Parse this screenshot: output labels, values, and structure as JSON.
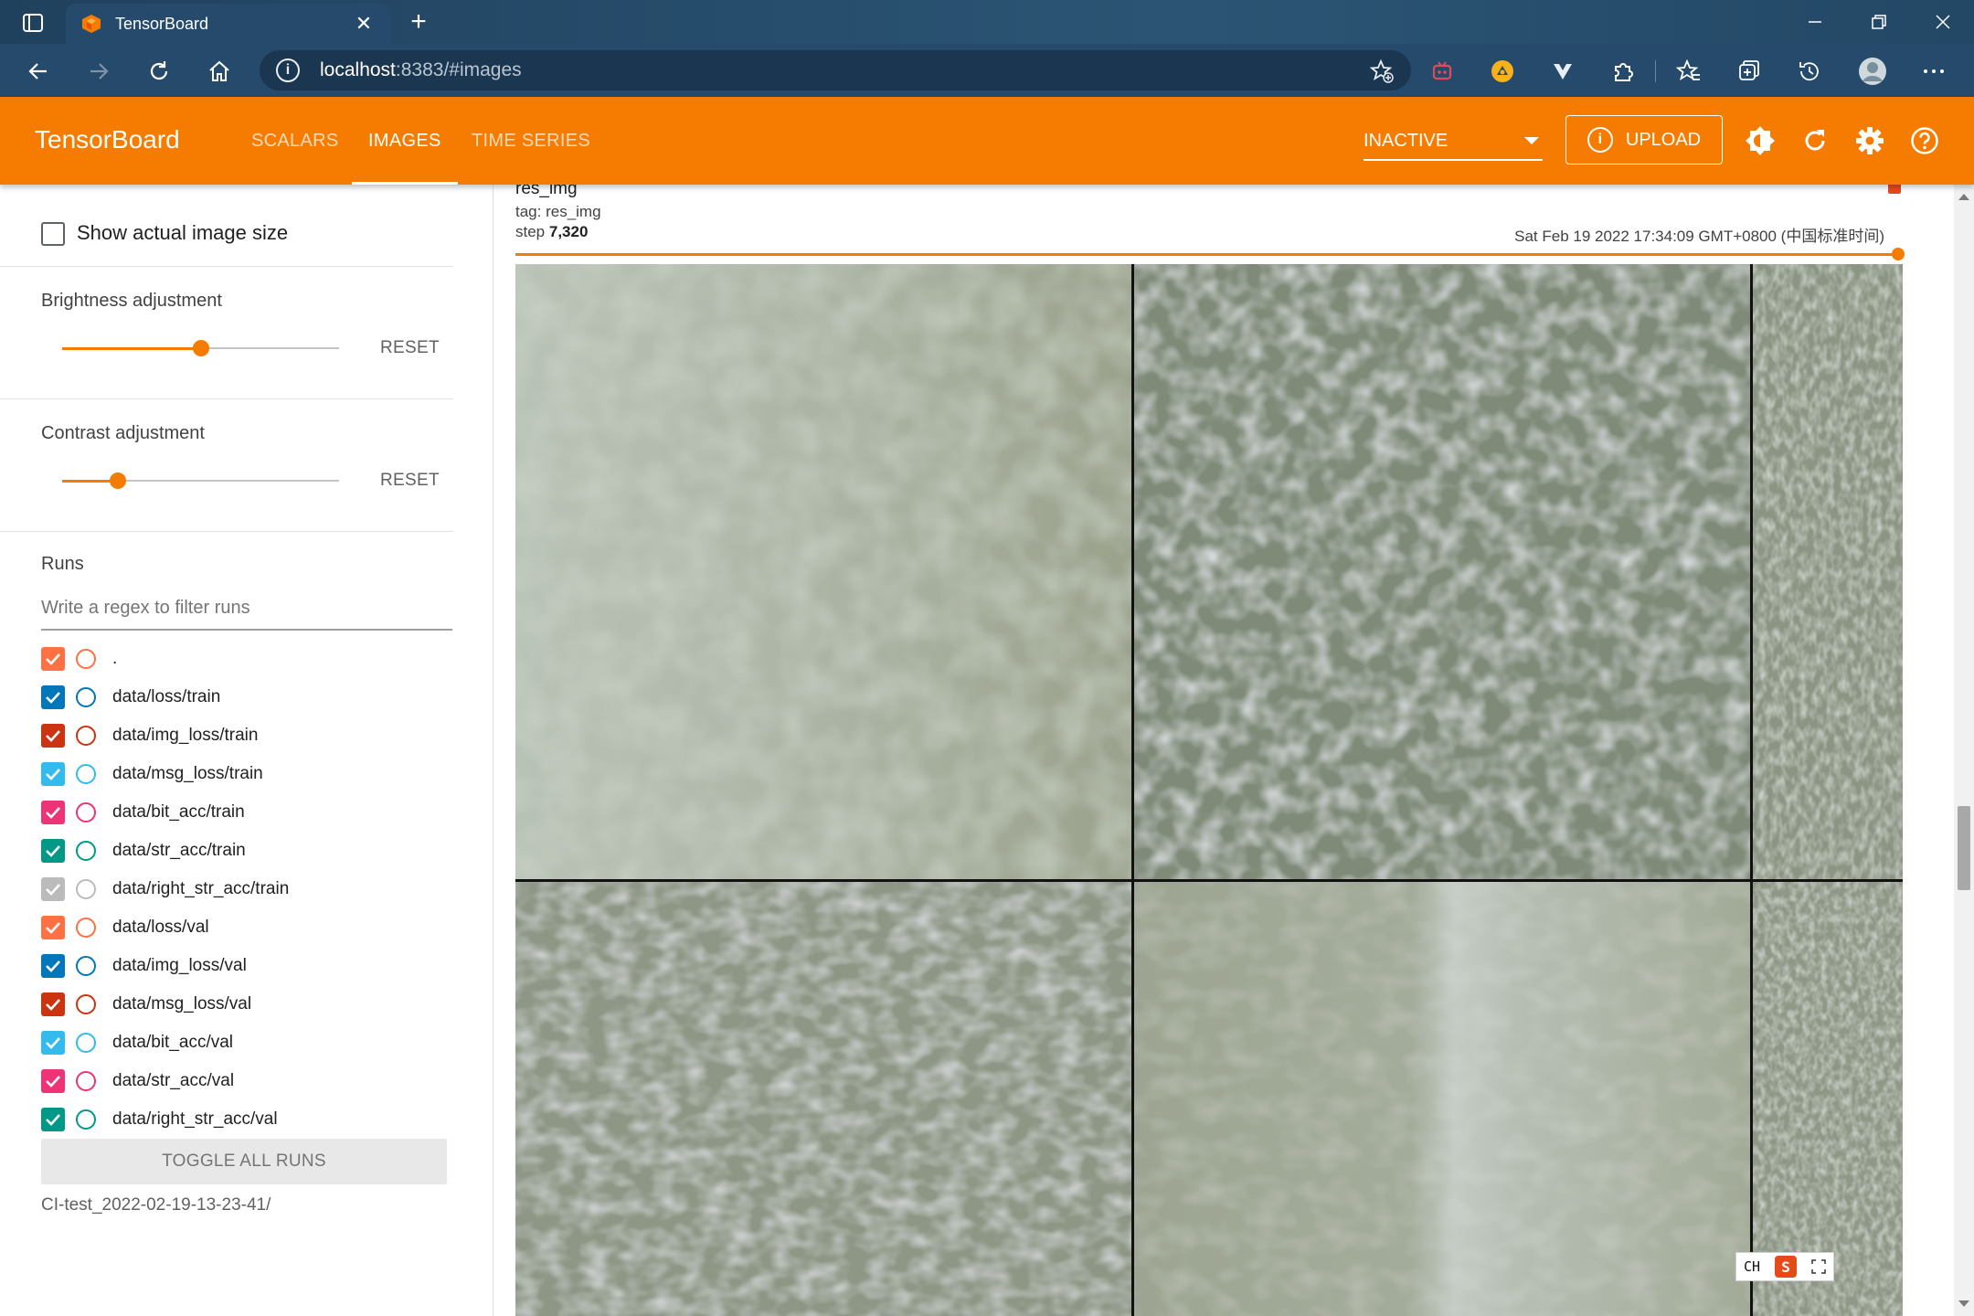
{
  "browser": {
    "tab_title": "TensorBoard",
    "url_host": "localhost",
    "url_rest": ":8383/#images"
  },
  "header": {
    "brand": "TensorBoard",
    "tabs": [
      {
        "label": "SCALARS",
        "active": false
      },
      {
        "label": "IMAGES",
        "active": true
      },
      {
        "label": "TIME SERIES",
        "active": false
      }
    ],
    "select_value": "INACTIVE",
    "upload_label": "UPLOAD",
    "accent_color": "#f57c00"
  },
  "sidebar": {
    "show_actual_size_label": "Show actual image size",
    "brightness": {
      "label": "Brightness adjustment",
      "reset": "RESET",
      "value_fraction": 0.5
    },
    "contrast": {
      "label": "Contrast adjustment",
      "reset": "RESET",
      "value_fraction": 0.2
    },
    "runs_heading": "Runs",
    "filter_placeholder": "Write a regex to filter runs",
    "runs": [
      {
        "name": ".",
        "color": "#ff7043",
        "checked": true
      },
      {
        "name": "data/loss/train",
        "color": "#0077bb",
        "checked": true
      },
      {
        "name": "data/img_loss/train",
        "color": "#cc3311",
        "checked": true
      },
      {
        "name": "data/msg_loss/train",
        "color": "#33bbee",
        "checked": true
      },
      {
        "name": "data/bit_acc/train",
        "color": "#ee3377",
        "checked": true
      },
      {
        "name": "data/str_acc/train",
        "color": "#009988",
        "checked": true
      },
      {
        "name": "data/right_str_acc/train",
        "color": "#bbbbbb",
        "checked": true
      },
      {
        "name": "data/loss/val",
        "color": "#ff7043",
        "checked": true
      },
      {
        "name": "data/img_loss/val",
        "color": "#0077bb",
        "checked": true
      },
      {
        "name": "data/msg_loss/val",
        "color": "#cc3311",
        "checked": true
      },
      {
        "name": "data/bit_acc/val",
        "color": "#33bbee",
        "checked": true
      },
      {
        "name": "data/str_acc/val",
        "color": "#ee3377",
        "checked": true
      },
      {
        "name": "data/right_str_acc/val",
        "color": "#009988",
        "checked": true
      }
    ],
    "toggle_all_label": "TOGGLE ALL RUNS",
    "logdir": "CI-test_2022-02-19-13-23-41/"
  },
  "card": {
    "title": "res_img",
    "tag": "tag: res_img",
    "step_label": "step",
    "step_value": "7,320",
    "timestamp": "Sat Feb 19 2022 17:34:09 GMT+0800 (中国标准时间)"
  },
  "ime": {
    "label": "CH",
    "logo": "S"
  }
}
